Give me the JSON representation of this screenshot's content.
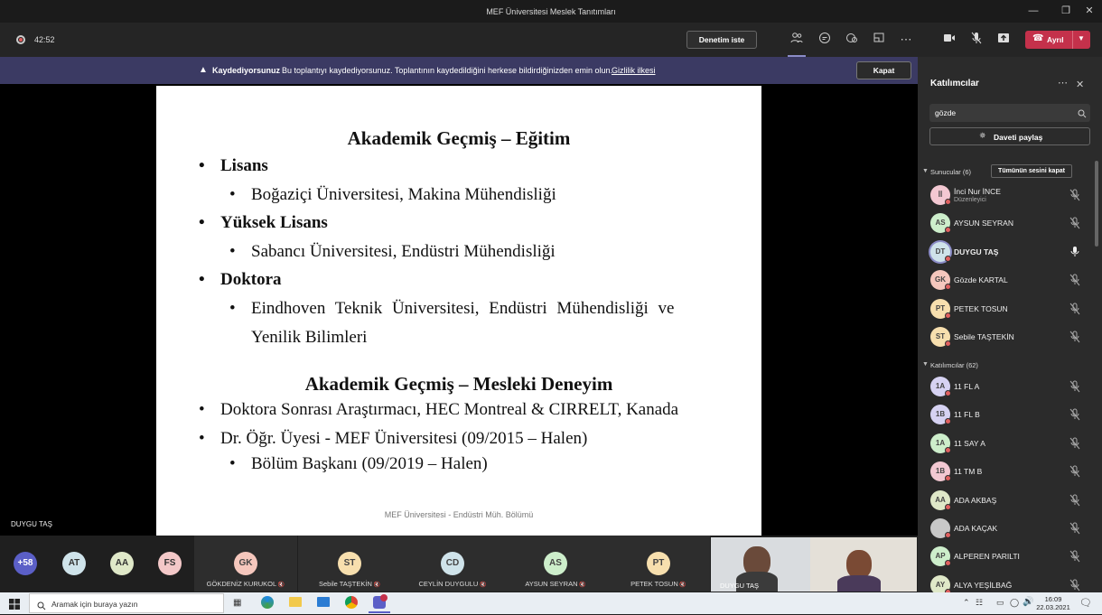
{
  "window": {
    "title": "MEF Üniversitesi Meslek Tanıtımları"
  },
  "toolbar": {
    "timer": "42:52",
    "try_button": "Denetim iste",
    "leave_button": "Ayrıl"
  },
  "banner": {
    "title": "Kaydediyorsunuz",
    "message": "Bu toplantıyı kaydediyorsunuz. Toplantının kaydedildiğini herkese bildirdiğinizden emin olun.",
    "link": "Gizlilik ilkesi",
    "close_button": "Kapat"
  },
  "slide": {
    "heading1": "Akademik Geçmiş – Eğitim",
    "items": [
      {
        "bullet": "•",
        "text": "Lisans",
        "bold": true
      },
      {
        "bullet": "•",
        "text": "Boğaziçi Üniversitesi, Makina Mühendisliği"
      },
      {
        "bullet": "•",
        "text": "Yüksek Lisans",
        "bold": true
      },
      {
        "bullet": "•",
        "text": "Sabancı Üniversitesi, Endüstri Mühendisliği"
      },
      {
        "bullet": "•",
        "text": "Doktora",
        "bold": true
      },
      {
        "bullet": "•",
        "text": "Eindhoven Teknik Üniversitesi, Endüstri Mühendisliği ve"
      },
      {
        "text": "Yenilik Bilimleri"
      }
    ],
    "heading2": "Akademik Geçmiş – Mesleki Deneyim",
    "items2": [
      {
        "bullet": "•",
        "text": "Doktora Sonrası Araştırmacı, HEC Montreal & CIRRELT, Kanada"
      },
      {
        "bullet": "•",
        "text": "Dr. Öğr. Üyesi - MEF Üniversitesi (09/2015 – Halen)"
      },
      {
        "bullet": "•",
        "text": "Bölüm Başkanı (09/2019 – Halen)"
      }
    ],
    "footer": "MEF Üniversitesi - Endüstri Müh. Bölümü",
    "presenter_label": "DUYGU TAŞ"
  },
  "strip": {
    "overflow": "+58",
    "small": [
      {
        "initials": "AT",
        "color": "#cfe3ea"
      },
      {
        "initials": "AA",
        "color": "#dfe8c8"
      },
      {
        "initials": "FS",
        "color": "#f3c8c8"
      }
    ],
    "tiles": [
      {
        "initials": "GK",
        "name": "GÖKDENİZ KURUKOL",
        "color": "#f5c7bd"
      },
      {
        "initials": "ST",
        "name": "Sebile TAŞTEKİN",
        "color": "#f7dfae"
      },
      {
        "initials": "CD",
        "name": "CEYLİN DUYGULU",
        "color": "#cfe3ea"
      },
      {
        "initials": "AS",
        "name": "AYSUN SEYRAN",
        "color": "#cdeecb"
      },
      {
        "initials": "PT",
        "name": "PETEK TOSUN",
        "color": "#f7dfae"
      }
    ],
    "video_name": "DUYGU TAŞ"
  },
  "panel": {
    "title": "Katılımcılar",
    "search_value": "gözde",
    "invite_button": "Daveti paylaş",
    "presenters_header": "Sunucular (6)",
    "mute_all": "Tümünün sesini kapat",
    "presenters": [
      {
        "initials": "İİ",
        "name": "İnci Nur İNCE",
        "role": "Düzenleyici",
        "color": "#f3c8d2"
      },
      {
        "initials": "AS",
        "name": "AYSUN SEYRAN",
        "color": "#cdeecb"
      },
      {
        "initials": "DT",
        "name": "DUYGU TAŞ",
        "color": "#cfe3ea",
        "active": true
      },
      {
        "initials": "GK",
        "name": "Gözde KARTAL",
        "color": "#f5c7bd"
      },
      {
        "initials": "PT",
        "name": "PETEK TOSUN",
        "color": "#f7dfae"
      },
      {
        "initials": "ST",
        "name": "Sebile TAŞTEKİN",
        "color": "#f7dfae"
      }
    ],
    "attendees_header": "Katılımcılar (62)",
    "attendees": [
      {
        "initials": "1A",
        "name": "11 FL A",
        "color": "#d6d2f2"
      },
      {
        "initials": "1B",
        "name": "11 FL B",
        "color": "#d6d2f2"
      },
      {
        "initials": "1A",
        "name": "11 SAY A",
        "color": "#cdeecb"
      },
      {
        "initials": "1B",
        "name": "11 TM B",
        "color": "#f3c8d2"
      },
      {
        "initials": "AA",
        "name": "ADA AKBAŞ",
        "color": "#dfe8c8"
      },
      {
        "initials": "",
        "name": "ADA KAÇAK",
        "color": "#c8c8c8"
      },
      {
        "initials": "AP",
        "name": "ALPEREN PARILTI",
        "color": "#cdeecb"
      },
      {
        "initials": "AY",
        "name": "ALYA YEŞİLBAĞ",
        "color": "#dfe8c8"
      }
    ]
  },
  "taskbar": {
    "search_placeholder": "Aramak için buraya yazın",
    "time": "16:09",
    "date": "22.03.2021"
  }
}
